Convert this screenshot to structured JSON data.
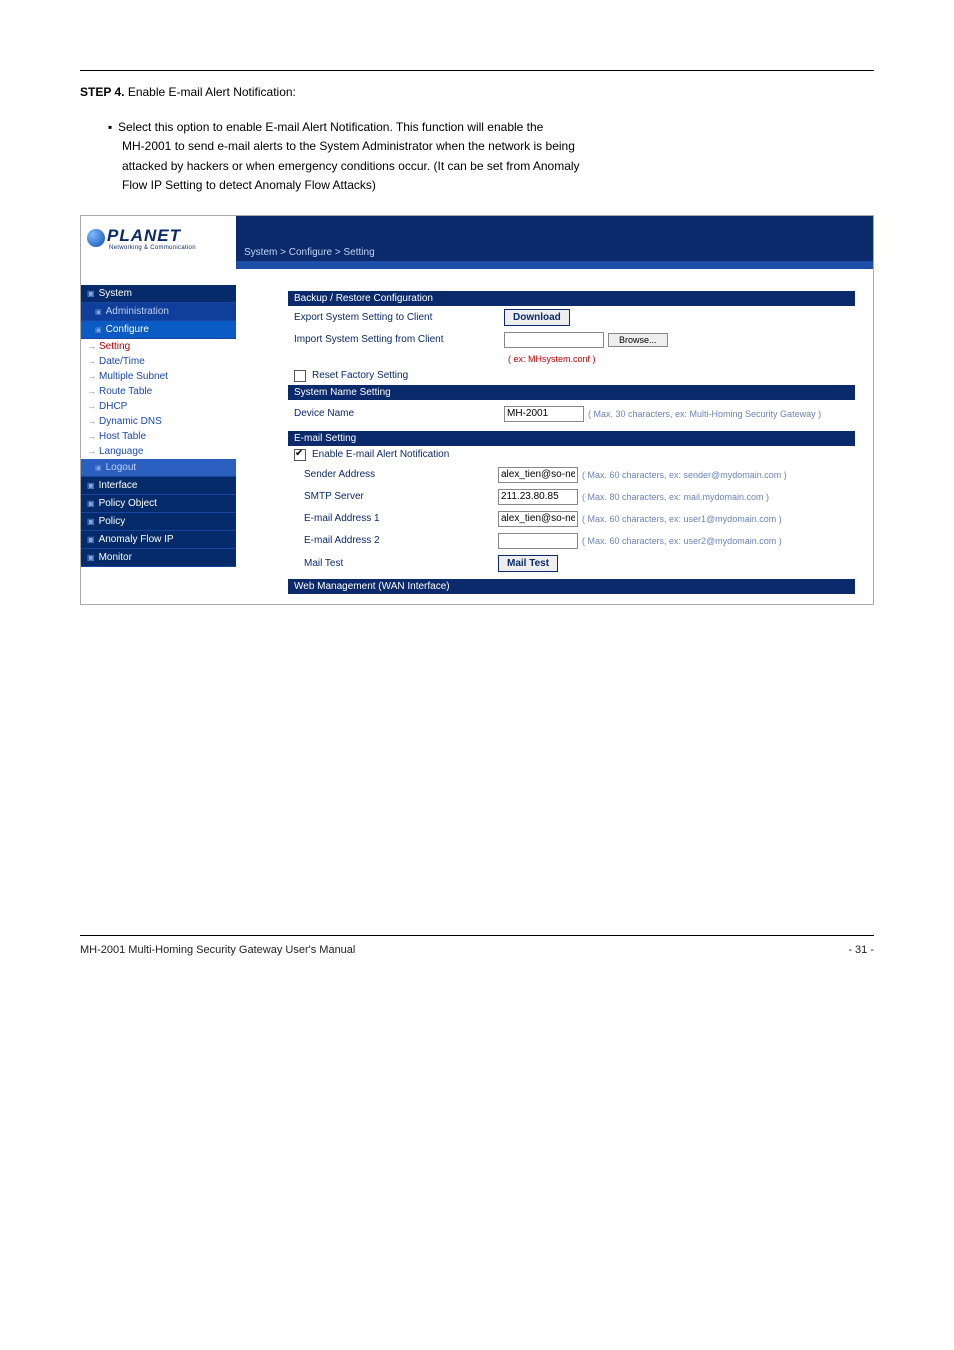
{
  "doc": {
    "intro_step_label": "STEP 4.",
    "intro_step_text": "Enable E-mail Alert Notification:",
    "instr1a": "Select this option to enable E-mail Alert Notification. This function will enable the",
    "instr1b": "MH-2001 to send e-mail alerts to the System Administrator when the network is being",
    "instr1c": "attacked by hackers or when emergency conditions occur. (It can be set from Anomaly",
    "instr1d": "Flow IP Setting to detect Anomaly Flow Attacks)",
    "footer_left": "MH-2001 Multi-Homing Security Gateway User's Manual",
    "footer_right": "- 31 -"
  },
  "breadcrumb": "System > Configure > Setting",
  "sidebar": {
    "logo": "PLANET",
    "logo_sub": "Networking & Communication",
    "items": [
      {
        "label": "System",
        "type": "hd"
      },
      {
        "label": "Administration",
        "type": "sub"
      },
      {
        "label": "Configure",
        "type": "sub",
        "sel": true
      },
      {
        "label": "Setting",
        "type": "leaf",
        "active": true
      },
      {
        "label": "Date/Time",
        "type": "leaf"
      },
      {
        "label": "Multiple Subnet",
        "type": "leaf"
      },
      {
        "label": "Route Table",
        "type": "leaf"
      },
      {
        "label": "DHCP",
        "type": "leaf"
      },
      {
        "label": "Dynamic DNS",
        "type": "leaf"
      },
      {
        "label": "Host Table",
        "type": "leaf"
      },
      {
        "label": "Language",
        "type": "leaf"
      },
      {
        "label": "Logout",
        "type": "sub"
      },
      {
        "label": "Interface",
        "type": "hd"
      },
      {
        "label": "Policy Object",
        "type": "hd"
      },
      {
        "label": "Policy",
        "type": "hd"
      },
      {
        "label": "Anomaly Flow IP",
        "type": "hd"
      },
      {
        "label": "Monitor",
        "type": "hd"
      }
    ]
  },
  "sections": {
    "backup": {
      "title": "Backup / Restore Configuration",
      "export_label": "Export System Setting to Client",
      "download_btn": "Download",
      "import_label": "Import System Setting from Client",
      "browse_btn": "Browse...",
      "import_hint": "( ex: MHsystem.conf )",
      "reset_label": "Reset Factory Setting"
    },
    "sysname": {
      "title": "System Name Setting",
      "device_name_label": "Device Name",
      "device_name_value": "MH-2001",
      "device_name_hint": "( Max. 30 characters, ex: Multi-Homing Security Gateway )"
    },
    "email": {
      "title": "E-mail Setting",
      "enable_label": "Enable E-mail Alert Notification",
      "enable_checked": true,
      "sender_label": "Sender Address",
      "sender_value": "alex_tien@so-net.ne",
      "sender_hint": "( Max. 60 characters, ex: sender@mydomain.com )",
      "smtp_label": "SMTP Server",
      "smtp_value": "211.23.80.85",
      "smtp_hint": "( Max. 80 characters, ex: mail.mydomain.com )",
      "addr1_label": "E-mail Address 1",
      "addr1_value": "alex_tien@so-net.ne",
      "addr1_hint": "( Max. 60 characters, ex: user1@mydomain.com )",
      "addr2_label": "E-mail Address 2",
      "addr2_value": "",
      "addr2_hint": "( Max. 60 characters, ex: user2@mydomain.com )",
      "mailtest_label": "Mail Test",
      "mailtest_btn": "Mail Test"
    },
    "webmgmt": {
      "title": "Web Management (WAN Interface)"
    }
  }
}
